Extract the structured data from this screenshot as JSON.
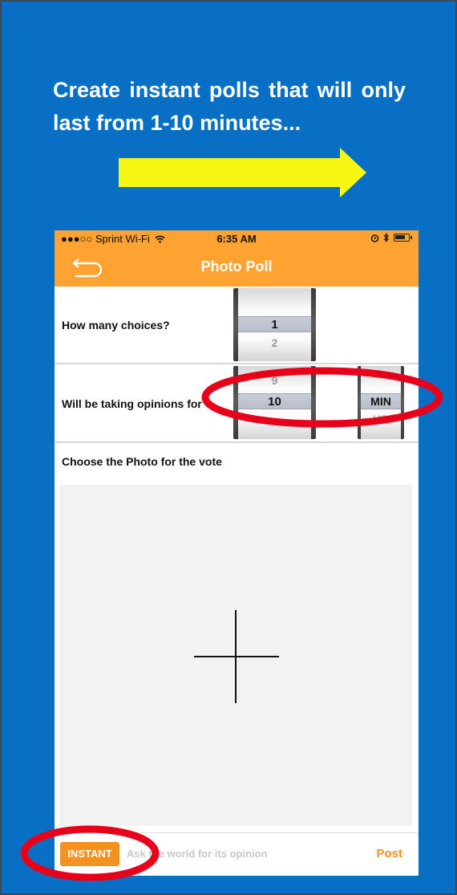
{
  "promo": {
    "headline": "Create instant polls that will only last from 1-10 minutes...",
    "arrow_color": "#f7f713",
    "highlight_color": "#e8001a",
    "background_color": "#0870c4"
  },
  "status_bar": {
    "carrier": "●●●○○ Sprint Wi-Fi",
    "time": "6:35 AM",
    "icons": [
      "wifi-icon",
      "alarm-icon",
      "bluetooth-icon",
      "battery-icon"
    ]
  },
  "nav": {
    "back_icon": "back-arrow-icon",
    "title": "Photo Poll",
    "bar_color": "#fea232"
  },
  "choices": {
    "label": "How many choices?",
    "picker": {
      "selected": "1",
      "next": "2"
    }
  },
  "duration": {
    "label": "Will be taking opinions fo",
    "occluded_char": "r ?",
    "value_picker": {
      "prev": "9",
      "selected": "10"
    },
    "unit_picker": {
      "selected": "MIN",
      "next": "HR"
    }
  },
  "photo": {
    "label": "Choose the Photo for the vote",
    "add_icon": "plus-icon"
  },
  "bottom": {
    "instant_label": "INSTANT",
    "input_placeholder": "Ask the world for its opinion",
    "post_label": "Post",
    "accent_color": "#f39121"
  }
}
